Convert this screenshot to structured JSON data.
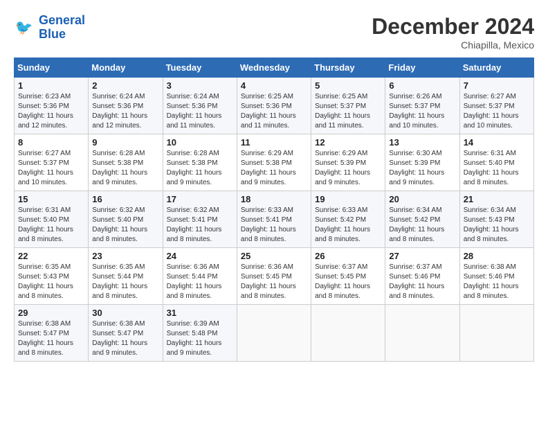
{
  "logo": {
    "line1": "General",
    "line2": "Blue"
  },
  "title": "December 2024",
  "subtitle": "Chiapilla, Mexico",
  "days_header": [
    "Sunday",
    "Monday",
    "Tuesday",
    "Wednesday",
    "Thursday",
    "Friday",
    "Saturday"
  ],
  "weeks": [
    [
      {
        "day": "1",
        "rise": "6:23 AM",
        "set": "5:36 PM",
        "daylight": "11 hours and 12 minutes."
      },
      {
        "day": "2",
        "rise": "6:24 AM",
        "set": "5:36 PM",
        "daylight": "11 hours and 12 minutes."
      },
      {
        "day": "3",
        "rise": "6:24 AM",
        "set": "5:36 PM",
        "daylight": "11 hours and 11 minutes."
      },
      {
        "day": "4",
        "rise": "6:25 AM",
        "set": "5:36 PM",
        "daylight": "11 hours and 11 minutes."
      },
      {
        "day": "5",
        "rise": "6:25 AM",
        "set": "5:37 PM",
        "daylight": "11 hours and 11 minutes."
      },
      {
        "day": "6",
        "rise": "6:26 AM",
        "set": "5:37 PM",
        "daylight": "11 hours and 10 minutes."
      },
      {
        "day": "7",
        "rise": "6:27 AM",
        "set": "5:37 PM",
        "daylight": "11 hours and 10 minutes."
      }
    ],
    [
      {
        "day": "8",
        "rise": "6:27 AM",
        "set": "5:37 PM",
        "daylight": "11 hours and 10 minutes."
      },
      {
        "day": "9",
        "rise": "6:28 AM",
        "set": "5:38 PM",
        "daylight": "11 hours and 9 minutes."
      },
      {
        "day": "10",
        "rise": "6:28 AM",
        "set": "5:38 PM",
        "daylight": "11 hours and 9 minutes."
      },
      {
        "day": "11",
        "rise": "6:29 AM",
        "set": "5:38 PM",
        "daylight": "11 hours and 9 minutes."
      },
      {
        "day": "12",
        "rise": "6:29 AM",
        "set": "5:39 PM",
        "daylight": "11 hours and 9 minutes."
      },
      {
        "day": "13",
        "rise": "6:30 AM",
        "set": "5:39 PM",
        "daylight": "11 hours and 9 minutes."
      },
      {
        "day": "14",
        "rise": "6:31 AM",
        "set": "5:40 PM",
        "daylight": "11 hours and 8 minutes."
      }
    ],
    [
      {
        "day": "15",
        "rise": "6:31 AM",
        "set": "5:40 PM",
        "daylight": "11 hours and 8 minutes."
      },
      {
        "day": "16",
        "rise": "6:32 AM",
        "set": "5:40 PM",
        "daylight": "11 hours and 8 minutes."
      },
      {
        "day": "17",
        "rise": "6:32 AM",
        "set": "5:41 PM",
        "daylight": "11 hours and 8 minutes."
      },
      {
        "day": "18",
        "rise": "6:33 AM",
        "set": "5:41 PM",
        "daylight": "11 hours and 8 minutes."
      },
      {
        "day": "19",
        "rise": "6:33 AM",
        "set": "5:42 PM",
        "daylight": "11 hours and 8 minutes."
      },
      {
        "day": "20",
        "rise": "6:34 AM",
        "set": "5:42 PM",
        "daylight": "11 hours and 8 minutes."
      },
      {
        "day": "21",
        "rise": "6:34 AM",
        "set": "5:43 PM",
        "daylight": "11 hours and 8 minutes."
      }
    ],
    [
      {
        "day": "22",
        "rise": "6:35 AM",
        "set": "5:43 PM",
        "daylight": "11 hours and 8 minutes."
      },
      {
        "day": "23",
        "rise": "6:35 AM",
        "set": "5:44 PM",
        "daylight": "11 hours and 8 minutes."
      },
      {
        "day": "24",
        "rise": "6:36 AM",
        "set": "5:44 PM",
        "daylight": "11 hours and 8 minutes."
      },
      {
        "day": "25",
        "rise": "6:36 AM",
        "set": "5:45 PM",
        "daylight": "11 hours and 8 minutes."
      },
      {
        "day": "26",
        "rise": "6:37 AM",
        "set": "5:45 PM",
        "daylight": "11 hours and 8 minutes."
      },
      {
        "day": "27",
        "rise": "6:37 AM",
        "set": "5:46 PM",
        "daylight": "11 hours and 8 minutes."
      },
      {
        "day": "28",
        "rise": "6:38 AM",
        "set": "5:46 PM",
        "daylight": "11 hours and 8 minutes."
      }
    ],
    [
      {
        "day": "29",
        "rise": "6:38 AM",
        "set": "5:47 PM",
        "daylight": "11 hours and 8 minutes."
      },
      {
        "day": "30",
        "rise": "6:38 AM",
        "set": "5:47 PM",
        "daylight": "11 hours and 9 minutes."
      },
      {
        "day": "31",
        "rise": "6:39 AM",
        "set": "5:48 PM",
        "daylight": "11 hours and 9 minutes."
      },
      null,
      null,
      null,
      null
    ]
  ],
  "labels": {
    "sunrise": "Sunrise:",
    "sunset": "Sunset:",
    "daylight": "Daylight:"
  }
}
